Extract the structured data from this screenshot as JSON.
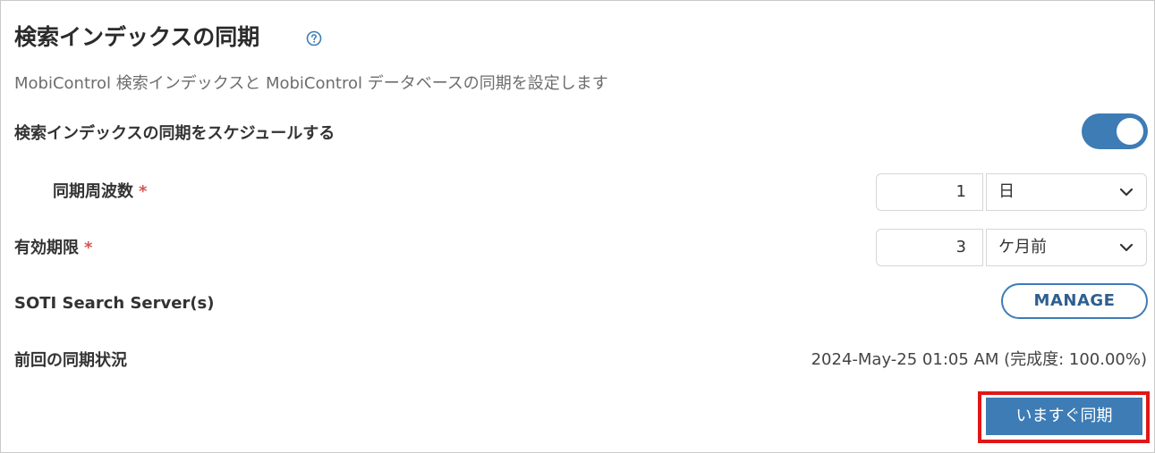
{
  "header": {
    "title": "検索インデックスの同期",
    "help_icon": "question-circle-icon",
    "description": "MobiControl 検索インデックスと MobiControl データベースの同期を設定します"
  },
  "schedule": {
    "label": "検索インデックスの同期をスケジュールする",
    "enabled": true
  },
  "frequency": {
    "label": "同期周波数",
    "required_mark": "*",
    "value": "1",
    "unit": "日"
  },
  "expiration": {
    "label": "有効期限",
    "required_mark": "*",
    "value": "3",
    "unit": "ケ月前"
  },
  "search_servers": {
    "label": "SOTI Search Server(s)",
    "manage_label": "MANAGE"
  },
  "last_sync": {
    "label": "前回の同期状況",
    "status": "2024-May-25 01:05 AM (完成度: 100.00%)"
  },
  "actions": {
    "sync_now_label": "いますぐ同期"
  },
  "colors": {
    "accent": "#3d7cb5",
    "required": "#d9534f",
    "highlight": "#e01717"
  }
}
